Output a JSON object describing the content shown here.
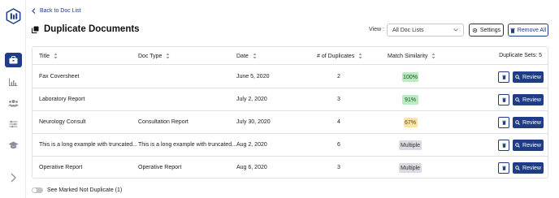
{
  "nav": {
    "back_label": "Back to Doc List",
    "items": [
      {
        "icon": "briefcase-icon",
        "active": true
      },
      {
        "icon": "bar-chart-icon",
        "active": false
      },
      {
        "icon": "users-icon",
        "active": false
      },
      {
        "icon": "sliders-icon",
        "active": false
      },
      {
        "icon": "graduation-cap-icon",
        "active": false
      }
    ]
  },
  "header": {
    "title": "Duplicate Documents",
    "view_label": "View :",
    "view_value": "All Doc Lists",
    "settings_label": "Settings",
    "remove_all_label": "Remove All"
  },
  "table": {
    "columns": {
      "title": "Title",
      "doc_type": "Doc Type",
      "date": "Date",
      "duplicates": "# of Duplicates",
      "similarity": "Match Similarity"
    },
    "duplicate_sets_label": "Duplicate Sets: 5",
    "review_label": "Review",
    "rows": [
      {
        "title": "Fax Coversheet",
        "doc_type": "",
        "date": "June 5, 2020",
        "duplicates": "2",
        "similarity": "100%",
        "similarity_color": "green"
      },
      {
        "title": "Laboratory Report",
        "doc_type": "",
        "date": "July 2, 2020",
        "duplicates": "3",
        "similarity": "91%",
        "similarity_color": "green"
      },
      {
        "title": "Neurology Consult",
        "doc_type": "Consultation Report",
        "date": "July 30, 2020",
        "duplicates": "4",
        "similarity": "67%",
        "similarity_color": "yellow"
      },
      {
        "title": "This is a long example with truncated...",
        "doc_type": "This is a long example with truncated...",
        "date": "Aug 2, 2020",
        "duplicates": "6",
        "similarity": "Multiple",
        "similarity_color": "gray"
      },
      {
        "title": "Operative Report",
        "doc_type": "Operative Report",
        "date": "Aug 6, 2020",
        "duplicates": "3",
        "similarity": "Multiple",
        "similarity_color": "gray"
      }
    ]
  },
  "footer": {
    "toggle_label": "See Marked Not Duplicate (1)",
    "toggle_on": false
  },
  "colors": {
    "primary": "#1f3c88",
    "badge_green": "#b9ecc1",
    "badge_yellow": "#fbe3a5",
    "badge_gray": "#d9dbe2"
  }
}
